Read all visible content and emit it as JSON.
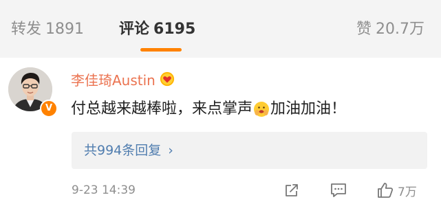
{
  "tabs": {
    "repost": {
      "label": "转发",
      "count": "1891"
    },
    "comment": {
      "label": "评论",
      "count": "6195"
    },
    "like": {
      "label": "赞",
      "count": "20.7万"
    }
  },
  "active_tab": "comment",
  "colors": {
    "accent": "#ff8200",
    "username": "#eb7350",
    "link": "#507daf",
    "muted": "#8e8e8e",
    "tab_bar_bg": "#f4f4f4",
    "reply_bg": "#f2f2f2"
  },
  "comment": {
    "username": "李佳琦Austin",
    "verified": true,
    "text_part1": "付总越来越棒啦，来点掌声",
    "emoji": "clapping-face-emoji",
    "text_part2": "加油加油！",
    "replies_label": "共994条回复",
    "timestamp": "9-23 14:39",
    "like_count": "7万"
  },
  "icons": [
    "member-heart-badge-icon",
    "verified-v-icon",
    "share-icon",
    "comment-icon",
    "thumbs-up-icon",
    "chevron-right-icon"
  ]
}
